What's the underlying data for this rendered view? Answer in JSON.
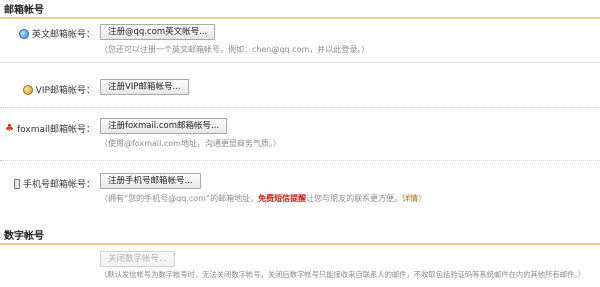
{
  "sections": {
    "mail_title": "邮箱帐号",
    "digit_title": "数字帐号"
  },
  "english": {
    "label": "英文邮箱帐号：",
    "button": "注册@qq.com英文帐号...",
    "hint": "（您还可以注册一个英文邮箱帐号，例如：chen@qq.com，并以此登录。）"
  },
  "vip": {
    "label": "VIP邮箱帐号：",
    "button": "注册VIP邮箱帐号..."
  },
  "foxmail": {
    "label": "foxmail邮箱帐号：",
    "button": "注册foxmail.com邮箱帐号...",
    "hint": "（使用@foxmail.com地址，沟通更显商务气质。）"
  },
  "mobile": {
    "label": "手机号邮箱帐号：",
    "button": "注册手机号邮箱帐号...",
    "hint_prefix": "（拥有“您的手机号@qq.com”的邮箱地址，",
    "hint_highlight": "免费短信提醒",
    "hint_suffix": "让您与朋友的联系更方便。",
    "hint_link": "详情",
    "hint_end": "）"
  },
  "digit": {
    "button": "关闭数字帐号...",
    "hint": "（默认发信帐号为数字帐号时，无法关闭数字帐号。关闭后数字帐号只能接收来自联系人的邮件，不收取包括验证码等系统邮件在内的其他所有邮件。）"
  },
  "icons": {
    "english": "globe-icon",
    "vip": "vip-badge-icon",
    "foxmail": "foxmail-logo-icon",
    "mobile": "mobile-phone-icon"
  },
  "colors": {
    "section_border": "#f3c98b",
    "highlight": "#d0200f",
    "link": "#c06010"
  }
}
